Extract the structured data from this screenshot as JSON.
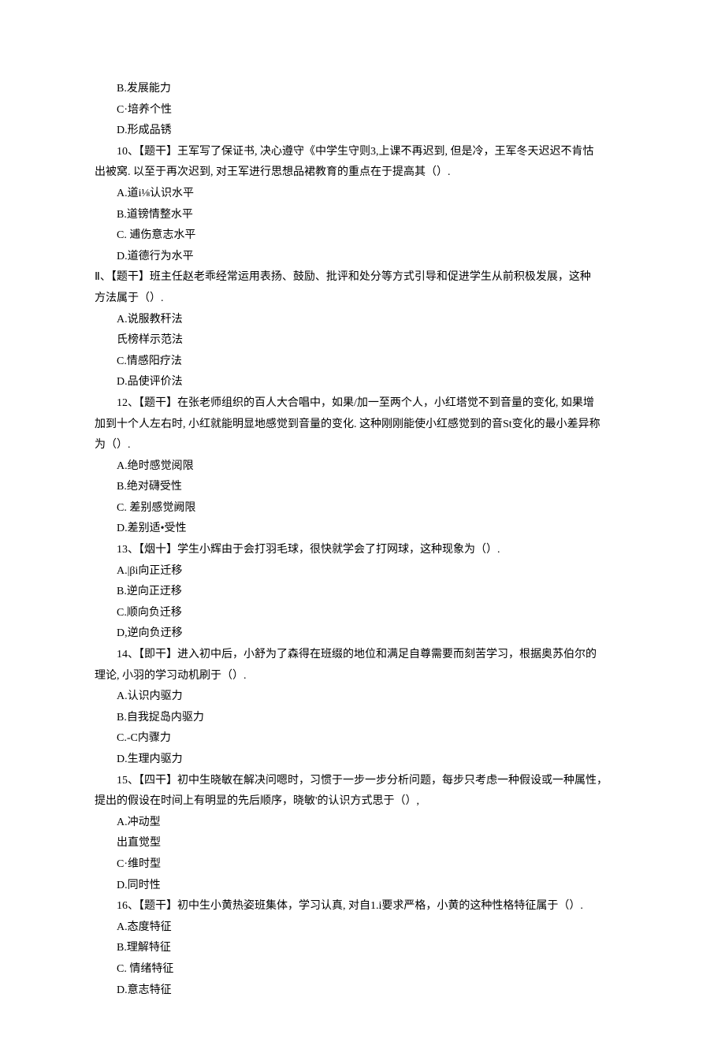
{
  "lines": [
    {
      "cls": "option",
      "text": "B.发展能力"
    },
    {
      "cls": "option",
      "text": "C·培养个性"
    },
    {
      "cls": "option",
      "text": "D.形成品锈"
    },
    {
      "cls": "question",
      "text": "10、【题干】王军写了保证书, 决心遵守《中学生守则3,上课不再迟到, 但是冷，王军冬天迟迟不肯怙"
    },
    {
      "cls": "continuation",
      "text": "出被窝. 以至于再次迟到, 对王军进行思想品裙教育的重点在于提高其（）."
    },
    {
      "cls": "option",
      "text": "A.道i⅛认识水平"
    },
    {
      "cls": "option",
      "text": "B.道镑情整水平"
    },
    {
      "cls": "option",
      "text": "C. 逋伤意志水平"
    },
    {
      "cls": "option",
      "text": "D.道德行为水平"
    },
    {
      "cls": "continuation",
      "text": "Ⅱ、【题干】班主任赵老乖经常运用表扬、鼓励、批评和处分等方式引导和促进学生从前积极发展，这种"
    },
    {
      "cls": "continuation",
      "text": "方法属于（）."
    },
    {
      "cls": "option",
      "text": "A.说服教秆法"
    },
    {
      "cls": "option",
      "text": "氏榜样示范法"
    },
    {
      "cls": "option",
      "text": "C.情感阳疗法"
    },
    {
      "cls": "option",
      "text": "D.品使评价法"
    },
    {
      "cls": "question",
      "text": "12、【题干】在张老师组织的百人大合唱中，如果/加一至两个人，小红塔觉不到音量的变化, 如果增"
    },
    {
      "cls": "continuation",
      "text": "加到十个人左右时, 小红就能明显地感觉到音量的变化. 这种刚刚能使小红感觉到的音St变化的最小差异称"
    },
    {
      "cls": "continuation",
      "text": "为（）."
    },
    {
      "cls": "option",
      "text": "A.绝时感觉阅限"
    },
    {
      "cls": "option",
      "text": "B.绝对礴受性"
    },
    {
      "cls": "option",
      "text": "C. 差别感觉阙限"
    },
    {
      "cls": "option",
      "text": "D.差别适•受性"
    },
    {
      "cls": "question",
      "text": "13、【烟十】学生小辉由于会打羽毛球，很快就学会了打网球，这种现象为（）."
    },
    {
      "cls": "option",
      "text": "A.|βi向正迁移"
    },
    {
      "cls": "option",
      "text": "B.逆向正迂移"
    },
    {
      "cls": "option",
      "text": "C.顺向负迁移"
    },
    {
      "cls": "option",
      "text": "D,逆向负迂移"
    },
    {
      "cls": "question",
      "text": "14、【即干】进入初中后，小舒为了森得在班缀的地位和满足自尊需要而刻苦学习，根据奥苏伯尔的"
    },
    {
      "cls": "continuation",
      "text": "理论, 小羽的学习动机刷于（）."
    },
    {
      "cls": "option",
      "text": "A.认识内驱力"
    },
    {
      "cls": "option",
      "text": "B.自我捉岛内驱力"
    },
    {
      "cls": "option",
      "text": "C.-C内骤力"
    },
    {
      "cls": "option",
      "text": "D.生理内驱力"
    },
    {
      "cls": "question",
      "text": "15、【四干】初中生晓敏在解决问嗯时，习惯于一步一步分析问题，每步只考虑一种假设或一种属性，"
    },
    {
      "cls": "continuation",
      "text": "提出的假设在时间上有明显的先后顺序，晓敏'的认识方式思于（）,"
    },
    {
      "cls": "option",
      "text": "A.冲动型"
    },
    {
      "cls": "option",
      "text": "出直觉型"
    },
    {
      "cls": "option",
      "text": "C·维时型"
    },
    {
      "cls": "option",
      "text": "D.同时性"
    },
    {
      "cls": "question",
      "text": "16、【题干】初中生小黄热姿班集体，学习认真, 对自1.i要求严格，小黄的这种性格特征属于（）."
    },
    {
      "cls": "option",
      "text": "A.态度特征"
    },
    {
      "cls": "option",
      "text": "B.理解特征"
    },
    {
      "cls": "option",
      "text": "C. 情绪特征"
    },
    {
      "cls": "option",
      "text": "D.意志特征"
    }
  ]
}
